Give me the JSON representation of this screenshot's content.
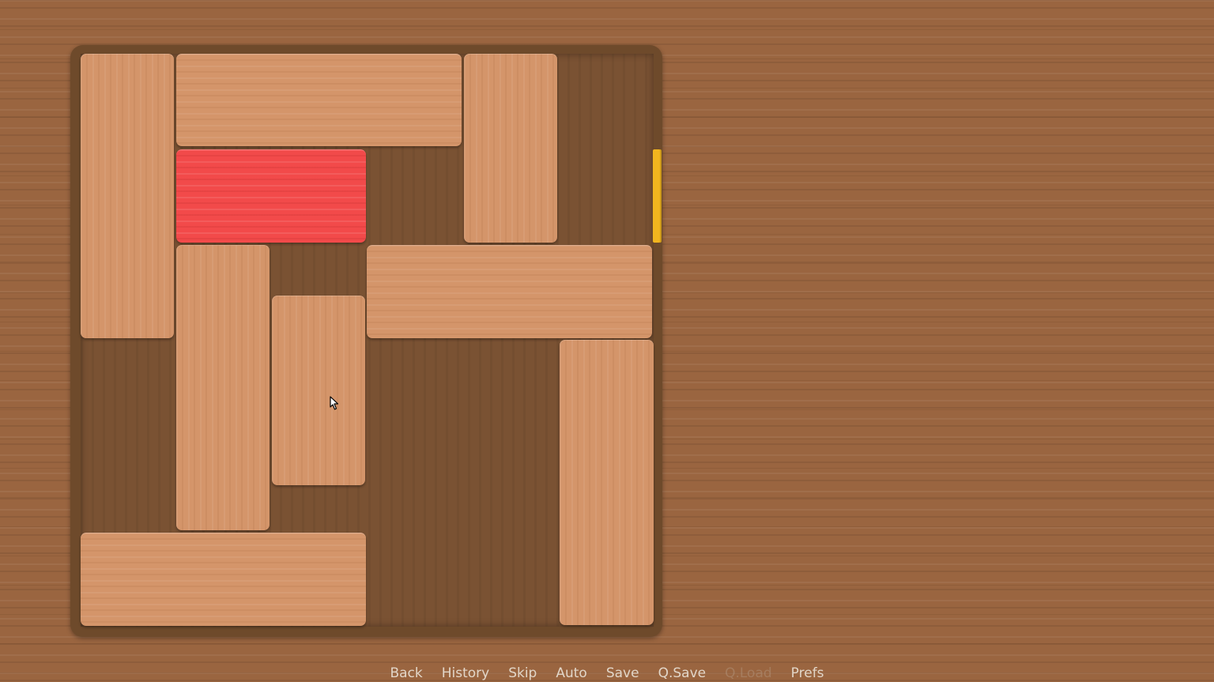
{
  "game": {
    "type": "sliding-block-puzzle",
    "grid_size": [
      6,
      6
    ],
    "colors": {
      "table_wood": "#9a6540",
      "board_frame": "#6e4a2b",
      "board_floor": "#7a5233",
      "block_wood": "#d4956a",
      "target_block": "#f24a4a",
      "exit_marker": "#f2b51f",
      "menu_text": "#e2d6c8"
    },
    "blocks": [
      {
        "id": "v-col0-rows0-2",
        "orientation": "vertical",
        "col": 0,
        "row": 0,
        "length": 3
      },
      {
        "id": "h-row0-cols1-3",
        "orientation": "horizontal",
        "col": 1,
        "row": 0,
        "length": 3
      },
      {
        "id": "v-col4-rows0-1",
        "orientation": "vertical",
        "col": 4,
        "row": 0,
        "length": 2
      },
      {
        "id": "target",
        "orientation": "horizontal",
        "col": 1,
        "row": 1,
        "length": 2,
        "is_target": true
      },
      {
        "id": "v-col1-rows2-4",
        "orientation": "vertical",
        "col": 1,
        "row": 2,
        "length": 3
      },
      {
        "id": "h-row2-cols3-5",
        "orientation": "horizontal",
        "col": 3,
        "row": 2,
        "length": 3
      },
      {
        "id": "v-col2-rows2.5-4.5",
        "orientation": "vertical",
        "col": 2,
        "row": 2.5,
        "length": 2
      },
      {
        "id": "v-col5-rows3-5",
        "orientation": "vertical",
        "col": 5,
        "row": 3,
        "length": 3
      },
      {
        "id": "h-row5-cols0-2",
        "orientation": "horizontal",
        "col": 0,
        "row": 5,
        "length": 3
      }
    ],
    "exit": {
      "side": "right",
      "row": 1
    }
  },
  "quick_menu": {
    "back": "Back",
    "history": "History",
    "skip": "Skip",
    "auto": "Auto",
    "save": "Save",
    "qsave": "Q.Save",
    "qload": "Q.Load",
    "prefs": "Prefs"
  },
  "icons": {
    "cursor": "arrow-cursor-icon"
  }
}
